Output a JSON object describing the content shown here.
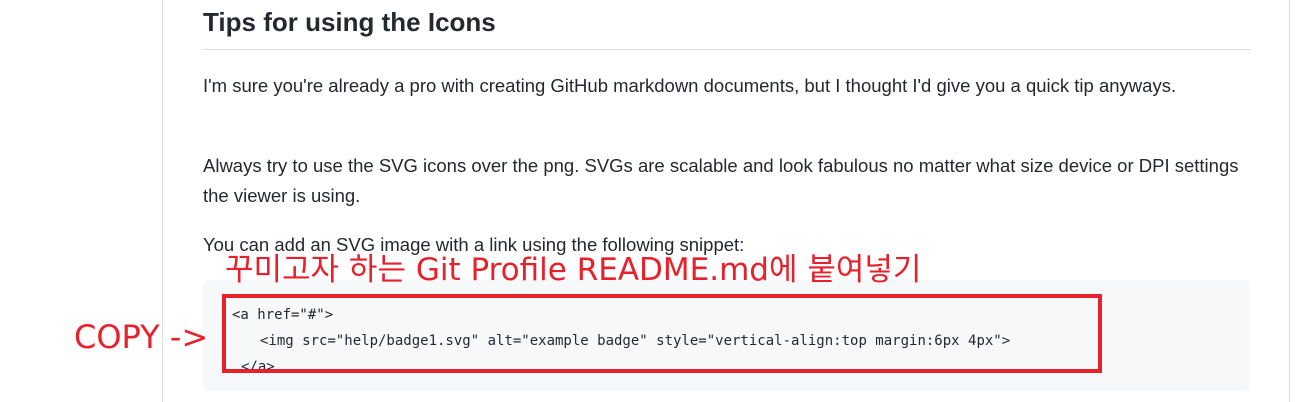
{
  "section": {
    "title": "Tips for using the Icons",
    "paragraphs": [
      "I'm sure you're already a pro with creating GitHub markdown documents, but I thought I'd give you a quick tip anyways.",
      "Always try to use the SVG icons over the png. SVGs are scalable and look fabulous no matter what size device or DPI settings the viewer is using.",
      "You can add an SVG image with a link using the following snippet:"
    ]
  },
  "code_snippet": {
    "lines": [
      "<a href=\"#\">",
      "<img src=\"help/badge1.svg\" alt=\"example badge\" style=\"vertical-align:top margin:6px 4px\">",
      "</a>"
    ]
  },
  "annotations": {
    "title": "꾸미고자 하는 Git Profile README.md에 붙여넣기",
    "copy_label": "COPY ->",
    "color": "#e8202a"
  },
  "colors": {
    "text": "#24292f",
    "code_background": "#f6f8fa",
    "rule": "#d8dee4"
  }
}
